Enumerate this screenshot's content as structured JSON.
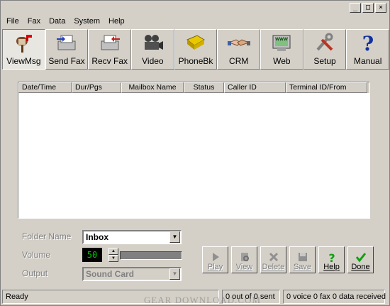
{
  "window": {
    "minimize": "_",
    "maximize": "□",
    "close": "×"
  },
  "menu": [
    "File",
    "Fax",
    "Data",
    "System",
    "Help"
  ],
  "toolbar": [
    {
      "label": "ViewMsg",
      "icon": "mailbox-icon"
    },
    {
      "label": "Send Fax",
      "icon": "send-fax-icon"
    },
    {
      "label": "Recv Fax",
      "icon": "recv-fax-icon"
    },
    {
      "label": "Video",
      "icon": "video-camera-icon"
    },
    {
      "label": "PhoneBk",
      "icon": "phonebook-icon"
    },
    {
      "label": "CRM",
      "icon": "handshake-icon"
    },
    {
      "label": "Web",
      "icon": "www-globe-icon"
    },
    {
      "label": "Setup",
      "icon": "tools-icon"
    },
    {
      "label": "Manual",
      "icon": "question-icon"
    }
  ],
  "table": {
    "columns": [
      "Date/Time",
      "Dur/Pgs",
      "Mailbox Name",
      "Status",
      "Caller ID",
      "Terminal ID/From"
    ]
  },
  "controls": {
    "folder_label": "Folder Name",
    "folder_value": "Inbox",
    "volume_label": "Volume",
    "volume_value": "50",
    "output_label": "Output",
    "output_value": "Sound Card"
  },
  "actions": [
    "Play",
    "View",
    "Delete",
    "Save",
    "Help",
    "Done"
  ],
  "status": {
    "ready": "Ready",
    "sent": "0 out of 0 sent",
    "received": "0 voice 0 fax 0 data  received"
  },
  "watermark": "GEAR DOWNLOAD.COM"
}
